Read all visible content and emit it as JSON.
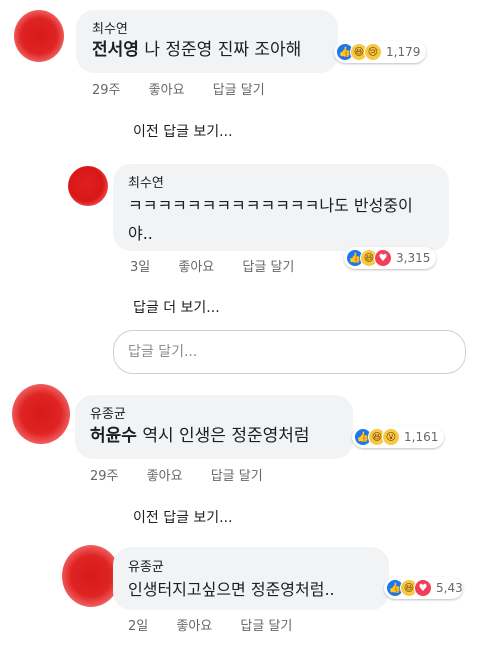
{
  "comments": [
    {
      "author": "최수연",
      "tag": "전서영",
      "text": " 나 정준영 진짜 조아해",
      "time": "29주",
      "like_label": "좋아요",
      "reply_label": "답글 달기",
      "reactions": [
        "like-icon",
        "haha-icon",
        "sad-icon"
      ],
      "reaction_count": "1,179"
    },
    {
      "author": "최수연",
      "text_line1": "ㅋㅋㅋㅋㅋㅋㅋㅋㅋㅋㅋㅋㅋ나도 반성중이",
      "text_line2": "야..",
      "time": "3일",
      "like_label": "좋아요",
      "reply_label": "답글 달기",
      "reactions": [
        "like-icon",
        "haha-icon",
        "love-icon"
      ],
      "reaction_count": "3,315"
    },
    {
      "author": "유종균",
      "tag": "허윤수",
      "text": " 역시 인생은 정준영처럼",
      "time": "29주",
      "like_label": "좋아요",
      "reply_label": "답글 달기",
      "reactions": [
        "like-icon",
        "haha-icon",
        "wow-icon"
      ],
      "reaction_count": "1,161"
    },
    {
      "author": "유종균",
      "text": "인생터지고싶으면 정준영처럼..",
      "time": "2일",
      "like_label": "좋아요",
      "reply_label": "답글 달기",
      "reactions": [
        "like-icon",
        "haha-icon",
        "love-icon"
      ],
      "reaction_count": "5,43"
    }
  ],
  "links": {
    "prev_replies_1": "이전 답글 보기...",
    "more_replies": "답글 더 보기...",
    "prev_replies_2": "이전 답글 보기..."
  },
  "reply_input": {
    "placeholder": "답글 달기...",
    "value": ""
  },
  "colors": {
    "bubble": "#f2f3f5",
    "like": "#1877f2",
    "love": "#f33e58",
    "haha": "#f7c843",
    "meta": "#65676b"
  }
}
